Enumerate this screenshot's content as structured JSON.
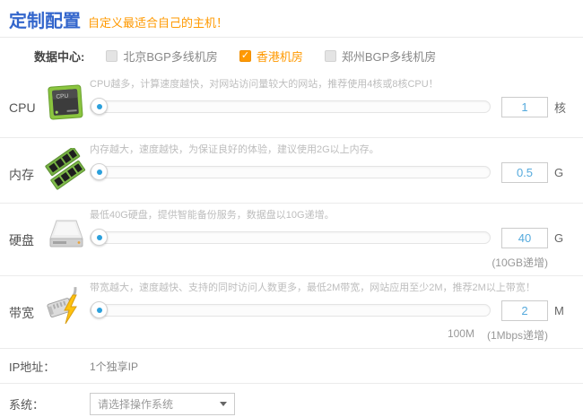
{
  "header": {
    "title": "定制配置",
    "subtitle": "自定义最适合自己的主机！"
  },
  "datacenter": {
    "label": "数据中心:",
    "options": [
      {
        "label": "北京BGP多线机房",
        "checked": false
      },
      {
        "label": "香港机房",
        "checked": true
      },
      {
        "label": "郑州BGP多线机房",
        "checked": false
      }
    ]
  },
  "rows": [
    {
      "label": "CPU",
      "icon": "cpu-icon",
      "description": "CPU越多，计算速度越快，对网站访问量较大的网站，推荐使用4核或8核CPU！",
      "value": "1",
      "unit": "核"
    },
    {
      "label": "内存",
      "icon": "memory-icon",
      "description": "内存越大，速度越快，为保证良好的体验，建议使用2G以上内存。",
      "value": "0.5",
      "unit": "G"
    },
    {
      "label": "硬盘",
      "icon": "disk-icon",
      "description": "最低40G硬盘，提供智能备份服务，数据盘以10G递增。",
      "value": "40",
      "unit": "G",
      "note": "(10GB递增)"
    },
    {
      "label": "带宽",
      "icon": "bandwidth-icon",
      "description": "带宽越大，速度越快、支持的同时访问人数更多，最低2M带宽，网站应用至少2M，推荐2M以上带宽！",
      "value": "2",
      "unit": "M",
      "max_label": "100M",
      "note": "(1Mbps递增)"
    }
  ],
  "ip": {
    "label": "IP地址：",
    "value": "1个独享IP"
  },
  "system": {
    "label": "系统：",
    "select_placeholder": "请选择操作系统"
  },
  "colors": {
    "accent_blue": "#3366cc",
    "accent_orange": "#ff9900",
    "slider_dot_blue": "#2ba0dc",
    "input_value_blue": "#55aadd"
  }
}
